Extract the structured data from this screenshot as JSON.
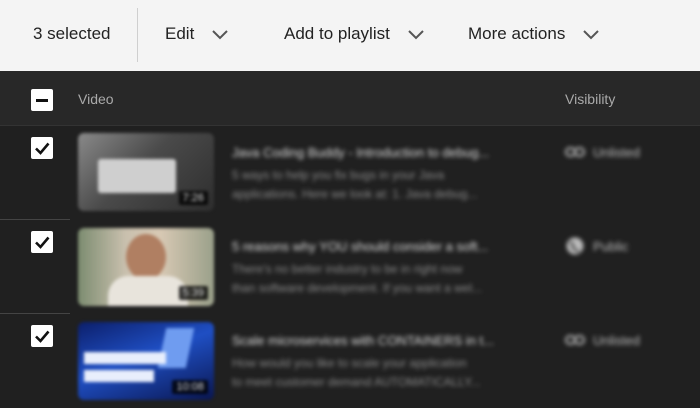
{
  "toolbar": {
    "selected_count": "3 selected",
    "edit_label": "Edit",
    "add_to_playlist_label": "Add to playlist",
    "more_actions_label": "More actions"
  },
  "table": {
    "col_video": "Video",
    "col_visibility": "Visibility"
  },
  "rows": [
    {
      "title": "Java Coding Buddy - Introduction to debug...",
      "desc_line1": "5 ways to help you fix bugs in your Java",
      "desc_line2": "applications. Here we look at: 1. Java debug...",
      "duration": "7:26",
      "visibility": "Unlisted",
      "visibility_icon": "link-icon"
    },
    {
      "title": "5 reasons why YOU should consider a soft...",
      "desc_line1": "There's no better industry to be in right now",
      "desc_line2": "than software development. If you want a wel...",
      "duration": "5:39",
      "visibility": "Public",
      "visibility_icon": "globe-icon"
    },
    {
      "title": "Scale microservices with CONTAINERS in t...",
      "desc_line1": "How would you like to scale your application",
      "desc_line2": "to meet customer demand AUTOMATICALLY...",
      "duration": "10:08",
      "visibility": "Unlisted",
      "visibility_icon": "link-icon"
    }
  ],
  "colors": {
    "toolbar_bg": "#f4f4f4",
    "table_bg": "#202020",
    "header_bg": "#282828"
  }
}
